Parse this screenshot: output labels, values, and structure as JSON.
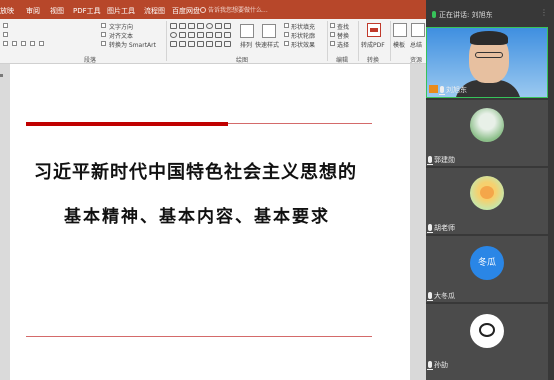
{
  "ribbon_tabs": [
    "放映",
    "审阅",
    "视图",
    "PDF工具",
    "图片工具",
    "流程图",
    "百度网盘"
  ],
  "search": {
    "placeholder": "告诉我您想要做什么..."
  },
  "ribbon": {
    "text_direction": "文字方向",
    "align_text": "对齐文本",
    "convert_smartart": "转换为 SmartArt",
    "arrange": "排列",
    "quick_styles": "快速样式",
    "shape_fill": "形状填充",
    "shape_outline": "形状轮廓",
    "shape_effects": "形状效果",
    "find": "查找",
    "replace": "替换",
    "select": "选择",
    "convert_pdf": "转成PDF",
    "template": "模板",
    "summary": "总结",
    "groups": {
      "paragraph": "段落",
      "drawing": "绘图",
      "editing": "编辑",
      "convert": "转换",
      "resources": "资源"
    }
  },
  "slide": {
    "line1": "习近平新时代中国特色社会主义思想的",
    "line2": "基本精神、基本内容、基本要求"
  },
  "meeting": {
    "speaking_label": "正在讲话: 刘旭东",
    "participants": [
      {
        "name": "刘旭东",
        "role": "presenter"
      },
      {
        "name": "郭建勋"
      },
      {
        "name": "胡老师"
      },
      {
        "name": "大冬瓜",
        "avatar_text": "冬瓜"
      },
      {
        "name": "孙劼"
      }
    ]
  },
  "colors": {
    "ribbon_accent": "#b7472a",
    "slide_title_bar": "#c00000",
    "active_speaker_border": "#37c35a",
    "panel_bg": "#383838"
  }
}
